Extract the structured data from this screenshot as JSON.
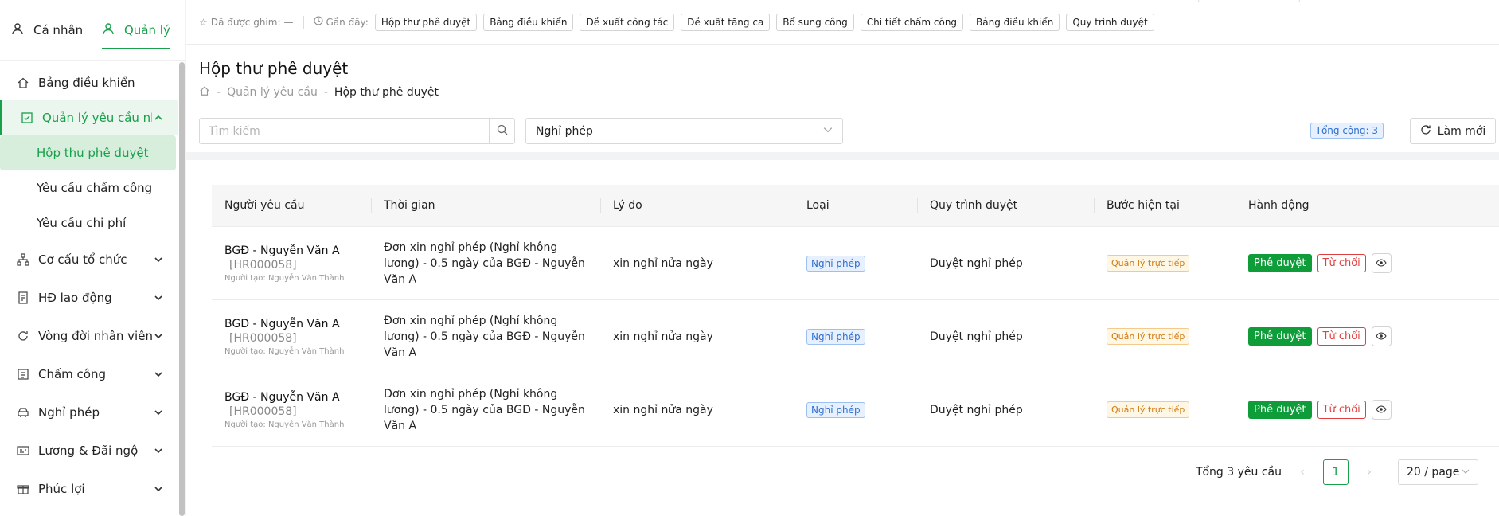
{
  "sidebar": {
    "tabs": [
      {
        "label": "Cá nhân"
      },
      {
        "label": "Quản lý"
      }
    ],
    "menu": [
      {
        "label": "Bảng điều khiển",
        "icon": "home-icon"
      },
      {
        "label": "Quản lý yêu cầu nh...",
        "icon": "checkbox-icon"
      },
      {
        "label": "Cơ cấu tổ chức",
        "icon": "org-chart-icon"
      },
      {
        "label": "HĐ lao động",
        "icon": "contract-icon"
      },
      {
        "label": "Vòng đời nhân viên",
        "icon": "cycle-icon"
      },
      {
        "label": "Chấm công",
        "icon": "list-icon"
      },
      {
        "label": "Nghỉ phép",
        "icon": "car-icon"
      },
      {
        "label": "Lương & Đãi ngộ",
        "icon": "payroll-icon"
      },
      {
        "label": "Phúc lợi",
        "icon": "gift-icon"
      }
    ],
    "submenu": [
      {
        "label": "Hộp thư phê duyệt"
      },
      {
        "label": "Yêu cầu chấm công"
      },
      {
        "label": "Yêu cầu chi phí"
      }
    ]
  },
  "topbar": {
    "pinned_label": "Đã được ghim:",
    "pinned_value": "—",
    "recent_label": "Gần đây:",
    "chips": [
      "Hộp thư phê duyệt",
      "Bảng điều khiển",
      "Đề xuất công tác",
      "Đề xuất tăng ca",
      "Bổ sung công",
      "Chi tiết chấm công",
      "Bảng điều khiển",
      "Quy trình duyệt"
    ]
  },
  "header": {
    "title": "Hộp thư phê duyệt",
    "breadcrumb": [
      "Quản lý yêu cầu",
      "Hộp thư phê duyệt"
    ],
    "search_placeholder": "Tìm kiếm",
    "filter_value": "Nghỉ phép",
    "total_badge": "Tổng cộng: 3",
    "refresh_label": "Làm mới"
  },
  "table": {
    "columns": [
      "Người yêu cầu",
      "Thời gian",
      "Lý do",
      "Loại",
      "Quy trình duyệt",
      "Bước hiện tại",
      "Hành động"
    ],
    "rows": [
      {
        "name": "BGĐ - Nguyễn Văn A",
        "code": "[HR000058]",
        "creator": "Người tạo: Nguyễn Văn Thành",
        "time": "Đơn xin nghỉ phép (Nghỉ không lương) - 0.5 ngày của BGĐ - Nguyễn Văn A",
        "reason": "xin nghỉ nửa ngày",
        "type": "Nghỉ phép",
        "flow": "Duyệt nghỉ phép",
        "step": "Quản lý trực tiếp",
        "approve": "Phê duyệt",
        "reject": "Từ chối"
      },
      {
        "name": "BGĐ - Nguyễn Văn A",
        "code": "[HR000058]",
        "creator": "Người tạo: Nguyễn Văn Thành",
        "time": "Đơn xin nghỉ phép (Nghỉ không lương) - 0.5 ngày của BGĐ - Nguyễn Văn A",
        "reason": "xin nghỉ nửa ngày",
        "type": "Nghỉ phép",
        "flow": "Duyệt nghỉ phép",
        "step": "Quản lý trực tiếp",
        "approve": "Phê duyệt",
        "reject": "Từ chối"
      },
      {
        "name": "BGĐ - Nguyễn Văn A",
        "code": "[HR000058]",
        "creator": "Người tạo: Nguyễn Văn Thành",
        "time": "Đơn xin nghỉ phép (Nghỉ không lương) - 0.5 ngày của BGĐ - Nguyễn Văn A",
        "reason": "xin nghỉ nửa ngày",
        "type": "Nghỉ phép",
        "flow": "Duyệt nghỉ phép",
        "step": "Quản lý trực tiếp",
        "approve": "Phê duyệt",
        "reject": "Từ chối"
      }
    ]
  },
  "pagination": {
    "total_text": "Tổng 3 yêu cầu",
    "current_page": "1",
    "page_size": "20 / page"
  },
  "colors": {
    "accent": "#18a04a",
    "approve": "#0f9d3a",
    "reject": "#e04040"
  }
}
